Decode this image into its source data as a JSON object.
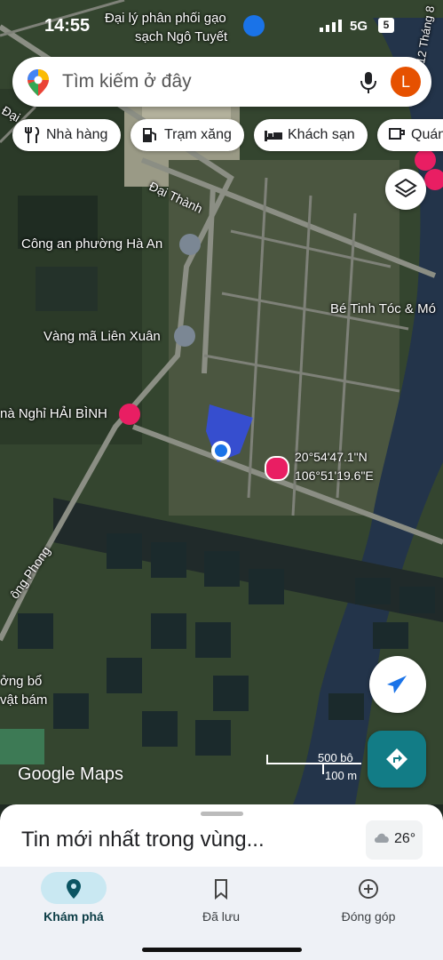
{
  "status": {
    "time": "14:55",
    "network": "5G",
    "battery": "5"
  },
  "search": {
    "placeholder": "Tìm kiếm ở đây",
    "avatar_initial": "L"
  },
  "chips": [
    {
      "label": "Nhà hàng",
      "icon": "fork-knife-icon"
    },
    {
      "label": "Trạm xăng",
      "icon": "gas-station-icon"
    },
    {
      "label": "Khách sạn",
      "icon": "bed-icon"
    },
    {
      "label": "Quán",
      "icon": "cafe-icon"
    }
  ],
  "map": {
    "labels": {
      "distributor": "Đại lý phân phối gạo",
      "distributor2": "sạch Ngô Tuyết",
      "road_dai_thanh": "Đại Thành",
      "police": "Công an phường Hà An",
      "vang_ma": "Vàng mã Liên Xuân",
      "be_tinh": "Bé Tinh Tóc & Mó",
      "nha_nghi": "nà Nghỉ HẢI BÌNH",
      "coord_lat": "20°54'47.1\"N",
      "coord_lon": "106°51'19.6\"E",
      "road_phong": "ông Phong",
      "dong_bo": "ởng bổ",
      "vat_bam": "vật bám",
      "road_12": "12 Tháng 8",
      "dai_left": "Đại"
    },
    "scale": {
      "top": "500 bộ",
      "bottom": "100 m"
    },
    "brand": "Google Maps"
  },
  "sheet": {
    "title": "Tin mới nhất trong vùng...",
    "weather": "26°"
  },
  "nav": [
    {
      "label": "Khám phá",
      "icon": "explore-pin-icon",
      "active": true
    },
    {
      "label": "Đã lưu",
      "icon": "bookmark-icon",
      "active": false
    },
    {
      "label": "Đóng góp",
      "icon": "add-circle-icon",
      "active": false
    }
  ],
  "colors": {
    "accent": "#1a73e8",
    "teal": "#127c86",
    "poi_pink": "#e91e63"
  }
}
